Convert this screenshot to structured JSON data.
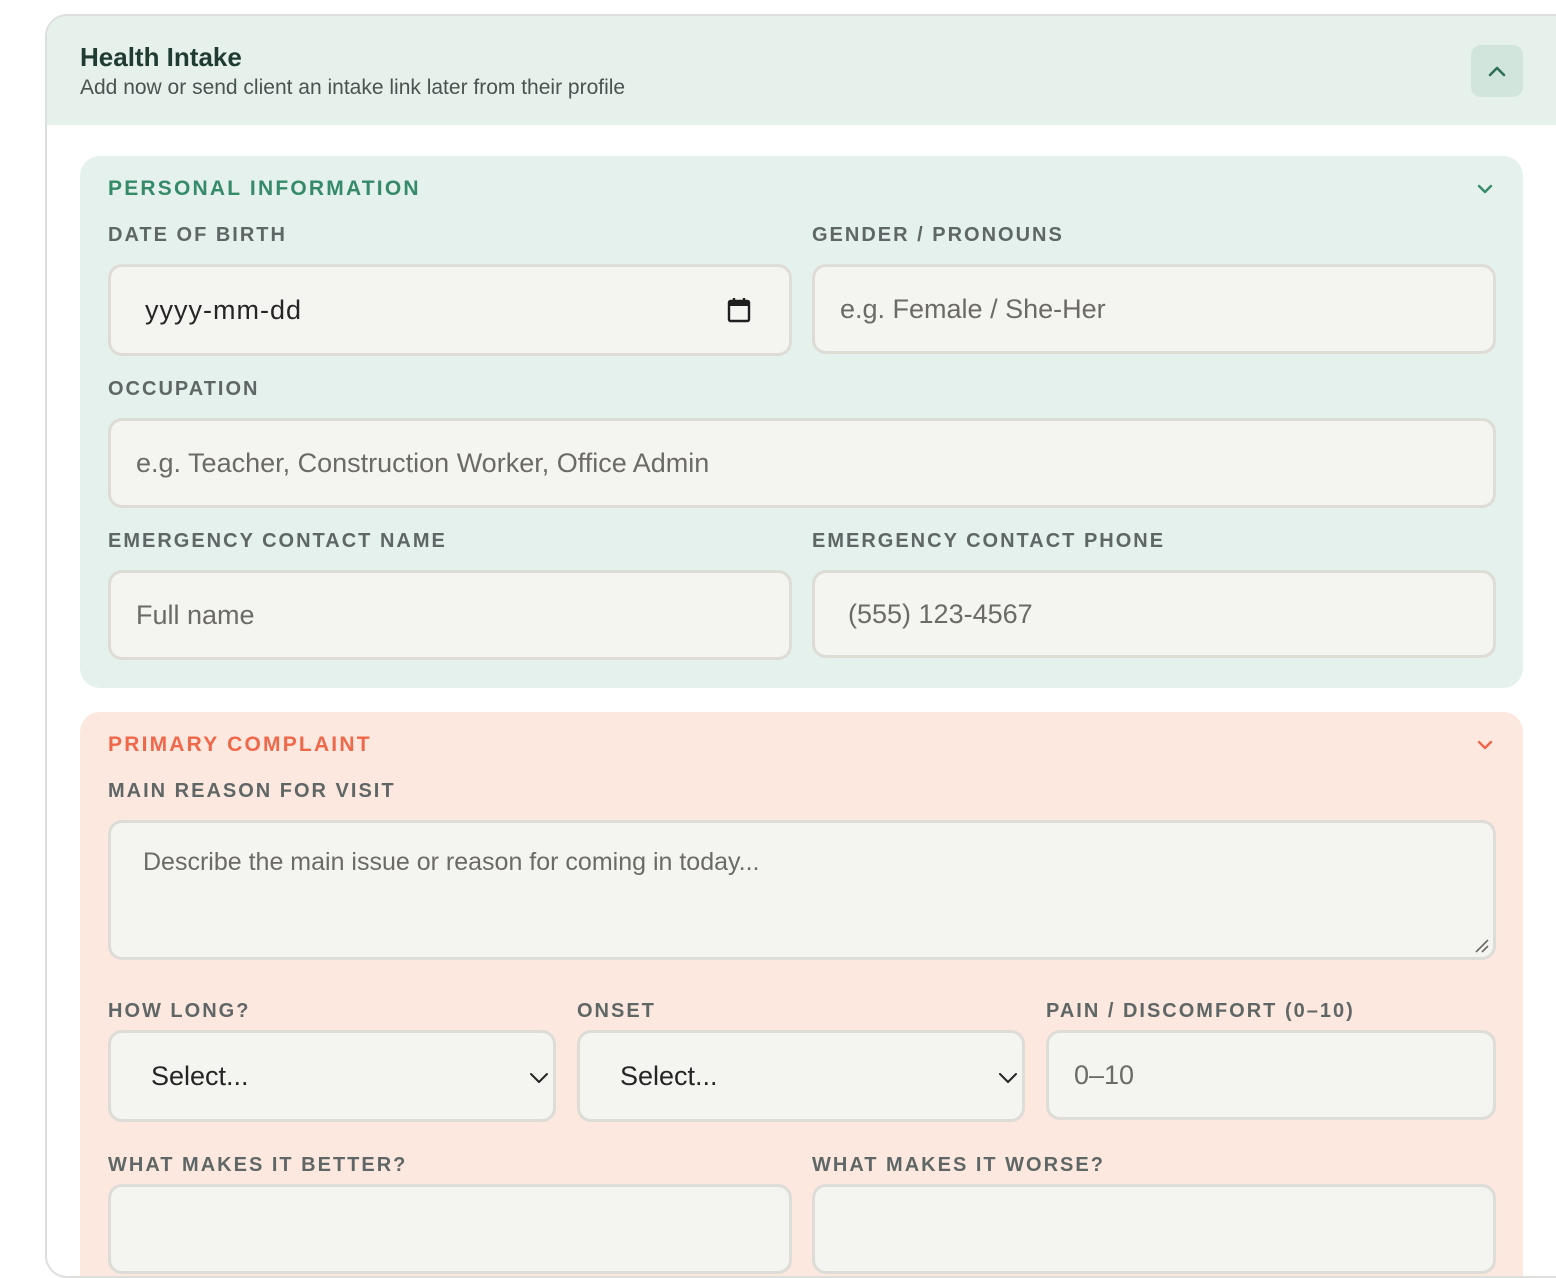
{
  "header": {
    "title": "Health Intake",
    "subtitle": "Add now or send client an intake link later from their profile",
    "collapse_icon": "chevron-up-icon"
  },
  "personal": {
    "title": "PERSONAL INFORMATION",
    "chevron_icon": "chevron-down-icon",
    "dob": {
      "label": "DATE OF BIRTH",
      "value": "yyyy-mm-dd",
      "icon": "calendar-icon"
    },
    "gender": {
      "label": "GENDER / PRONOUNS",
      "placeholder": "e.g. Female / She-Her"
    },
    "occupation": {
      "label": "OCCUPATION",
      "placeholder": "e.g. Teacher, Construction Worker, Office Admin"
    },
    "ec_name": {
      "label": "EMERGENCY CONTACT NAME",
      "placeholder": "Full name"
    },
    "ec_phone": {
      "label": "EMERGENCY CONTACT PHONE",
      "placeholder": "(555) 123-4567"
    }
  },
  "complaint": {
    "title": "PRIMARY COMPLAINT",
    "chevron_icon": "chevron-down-icon",
    "reason": {
      "label": "MAIN REASON FOR VISIT",
      "placeholder": "Describe the main issue or reason for coming in today..."
    },
    "how_long": {
      "label": "HOW LONG?",
      "value": "Select..."
    },
    "onset": {
      "label": "ONSET",
      "value": "Select..."
    },
    "pain": {
      "label": "PAIN / DISCOMFORT (0–10)",
      "placeholder": "0–10"
    },
    "better": {
      "label": "WHAT MAKES IT BETTER?"
    },
    "worse": {
      "label": "WHAT MAKES IT WORSE?"
    }
  },
  "colors": {
    "header_bg": "#e6f1ec",
    "personal_accent": "#358a6a",
    "complaint_accent": "#f0684a",
    "complaint_bg": "#fde8e0"
  }
}
